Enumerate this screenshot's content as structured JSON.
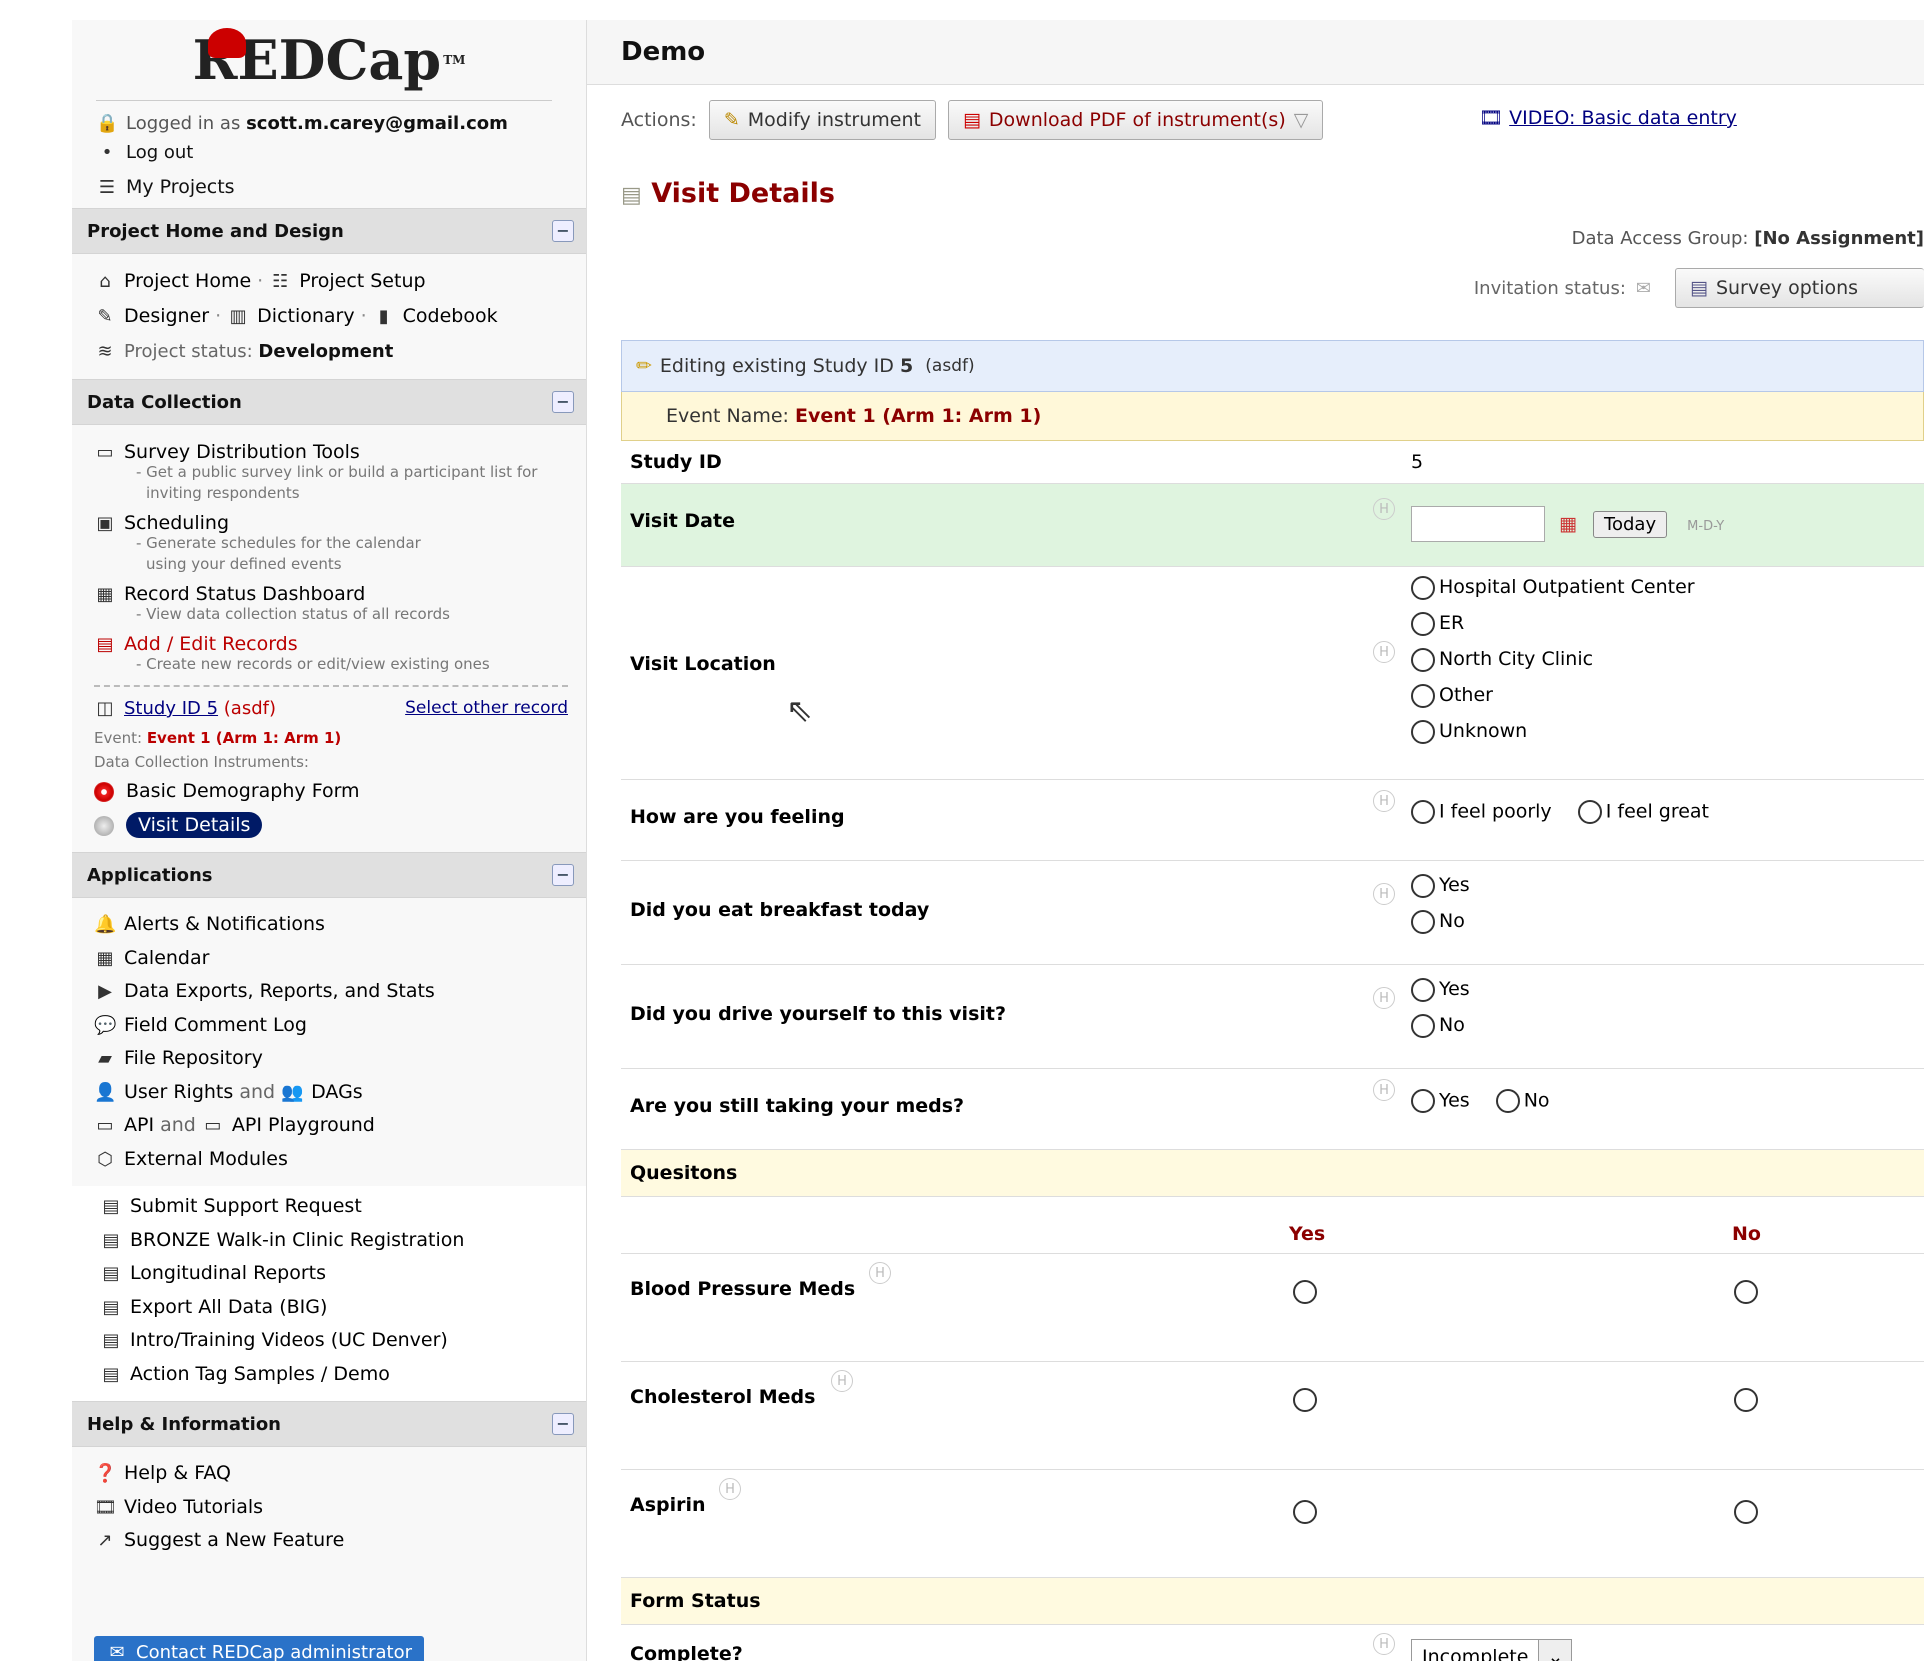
{
  "brand": {
    "name": "REDCap",
    "tm": "TM"
  },
  "user": {
    "logged_in_prefix": "Logged in as",
    "email": "scott.m.carey@gmail.com",
    "logout": "Log out",
    "my_projects": "My Projects"
  },
  "sections": {
    "project_home": "Project Home and Design",
    "data_collection": "Data Collection",
    "applications": "Applications",
    "help": "Help & Information"
  },
  "project_home": {
    "home": "Project Home",
    "setup": "Project Setup",
    "designer": "Designer",
    "dictionary": "Dictionary",
    "codebook": "Codebook",
    "status_label": "Project status:",
    "status_value": "Development"
  },
  "data_collection": {
    "survey_tools": "Survey Distribution Tools",
    "survey_tools_desc1": "- Get a public survey link or build a participant list for",
    "survey_tools_desc2": "inviting respondents",
    "scheduling": "Scheduling",
    "scheduling_desc1": "- Generate schedules for the calendar",
    "scheduling_desc2": "using your defined events",
    "dashboard": "Record Status Dashboard",
    "dashboard_desc": "- View data collection status of all records",
    "add_edit": "Add / Edit Records",
    "add_edit_desc": "- Create new records or edit/view existing ones",
    "study_link": "Study ID 5",
    "study_suffix": "(asdf)",
    "select_other": "Select other record",
    "event_label": "Event:",
    "event_value": "Event 1 (Arm 1: Arm 1)",
    "instruments_label": "Data Collection Instruments:",
    "instrument1": "Basic Demography Form",
    "instrument2": "Visit Details"
  },
  "applications": [
    "Alerts & Notifications",
    "Calendar",
    "Data Exports, Reports, and Stats",
    "Field Comment Log",
    "File Repository"
  ],
  "apps_extra": {
    "user_rights": "User Rights",
    "and": "and",
    "dags": "DAGs",
    "api": "API",
    "api_playground": "API Playground",
    "external_modules": "External Modules"
  },
  "bookmarks": [
    "Submit Support Request",
    "BRONZE Walk-in Clinic Registration",
    "Longitudinal Reports",
    "Export All Data (BIG)",
    "Intro/Training Videos (UC Denver)",
    "Action Tag Samples / Demo"
  ],
  "help": {
    "faq": "Help & FAQ",
    "videos": "Video Tutorials",
    "suggest": "Suggest a New Feature",
    "contact": "Contact REDCap administrator"
  },
  "main": {
    "project_title": "Demo",
    "actions_label": "Actions:",
    "modify": "Modify instrument",
    "download": "Download PDF of instrument(s)",
    "video": "VIDEO: Basic data entry",
    "form_title": "Visit Details",
    "dag_label": "Data Access Group:",
    "dag_value": "[No Assignment]",
    "invite_label": "Invitation status:",
    "survey_options": "Survey options",
    "editing_prefix": "Editing existing Study ID",
    "editing_id": "5",
    "editing_suffix": "(asdf)",
    "event_name_label": "Event Name:",
    "event_name_value": "Event 1 (Arm 1: Arm 1)"
  },
  "fields": {
    "study_id_label": "Study ID",
    "study_id_value": "5",
    "visit_date_label": "Visit Date",
    "today": "Today",
    "date_format": "M-D-Y",
    "visit_location_label": "Visit Location",
    "visit_location_options": [
      "Hospital Outpatient Center",
      "ER",
      "North City Clinic",
      "Other",
      "Unknown"
    ],
    "feeling_label": "How are you feeling",
    "feeling_options": [
      "I feel poorly",
      "I feel great"
    ],
    "breakfast_label": "Did you eat breakfast today",
    "drive_label": "Did you drive yourself to this visit?",
    "meds_label": "Are you still taking your meds?",
    "yes": "Yes",
    "no": "No",
    "questions_header": "Quesitons",
    "matrix_yes": "Yes",
    "matrix_no": "No",
    "bp_meds": "Blood Pressure Meds",
    "chol_meds": "Cholesterol Meds",
    "aspirin": "Aspirin",
    "form_status_header": "Form Status",
    "complete_label": "Complete?",
    "complete_value": "Incomplete"
  },
  "colors": {
    "accent_red": "#8b0000",
    "brand_red": "#cc0000",
    "nav_blue": "#001a66",
    "edit_bg": "#e6eefb",
    "event_bg": "#fff8d9",
    "row_green": "#dff4df"
  }
}
